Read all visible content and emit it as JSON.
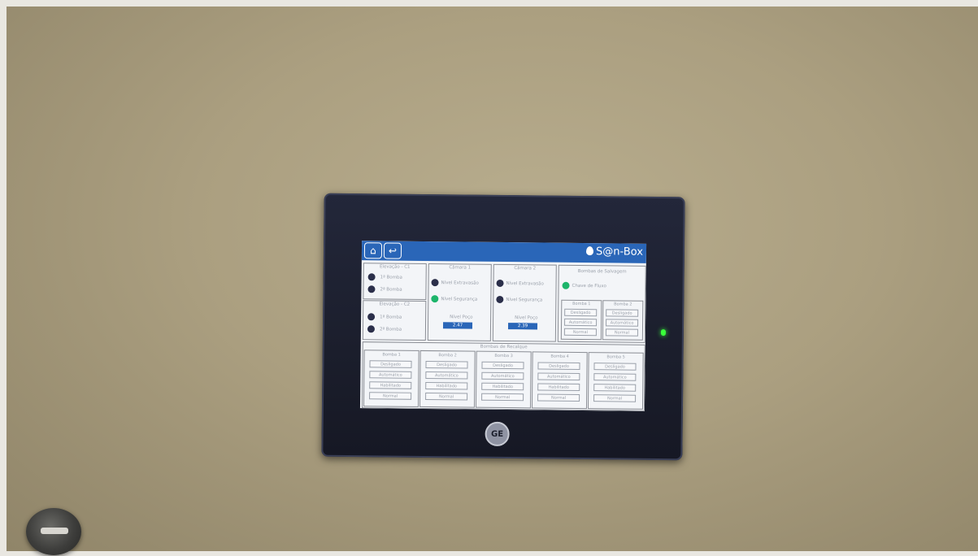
{
  "hmi": {
    "brand": "S@n-Box",
    "panels": {
      "elevacao1": {
        "title": "Elevação - C1",
        "items": [
          "1ª Bomba",
          "2ª Bomba"
        ]
      },
      "elevacao2": {
        "title": "Elevação - C2",
        "items": [
          "1ª Bomba",
          "2ª Bomba"
        ]
      },
      "camara1": {
        "title": "Câmara 1",
        "nivel_extravasao": "Nível Extravasão",
        "nivel_seguranca": "Nível Segurança",
        "nivel_poco": "Nível Poço",
        "nivel_poco_value": "2.47"
      },
      "camara2": {
        "title": "Câmara 2",
        "nivel_extravasao": "Nível Extravasão",
        "nivel_seguranca": "Nível Segurança",
        "nivel_poco": "Nível Poço",
        "nivel_poco_value": "2.39"
      },
      "bombas_salvagem": {
        "title": "Bombas de Salvagem",
        "chave": "Chave de Fluxo",
        "columns": [
          {
            "name": "Bomba 1",
            "cells": [
              "Desligado",
              "Automático",
              "Normal"
            ]
          },
          {
            "name": "Bomba 2",
            "cells": [
              "Desligado",
              "Automático",
              "Normal"
            ]
          }
        ]
      },
      "bombas_recalque": {
        "title": "Bombas de Recalque",
        "columns": [
          {
            "name": "Bomba 1",
            "cells": [
              "Desligado",
              "Automático",
              "Habilitado",
              "Normal"
            ]
          },
          {
            "name": "Bomba 2",
            "cells": [
              "Desligado",
              "Automático",
              "Habilitado",
              "Normal"
            ]
          },
          {
            "name": "Bomba 3",
            "cells": [
              "Desligado",
              "Automático",
              "Habilitado",
              "Normal"
            ]
          },
          {
            "name": "Bomba 4",
            "cells": [
              "Desligado",
              "Automático",
              "Habilitado",
              "Normal"
            ]
          },
          {
            "name": "Bomba 5",
            "cells": [
              "Desligado",
              "Automático",
              "Habilitado",
              "Normal"
            ]
          }
        ]
      }
    }
  },
  "bezel_logo": "GE",
  "colors": {
    "titlebar": "#2a66b8",
    "lamp_on": "#1db56b",
    "lamp_off": "#2b2f4a",
    "status_led": "#39ff3a"
  }
}
